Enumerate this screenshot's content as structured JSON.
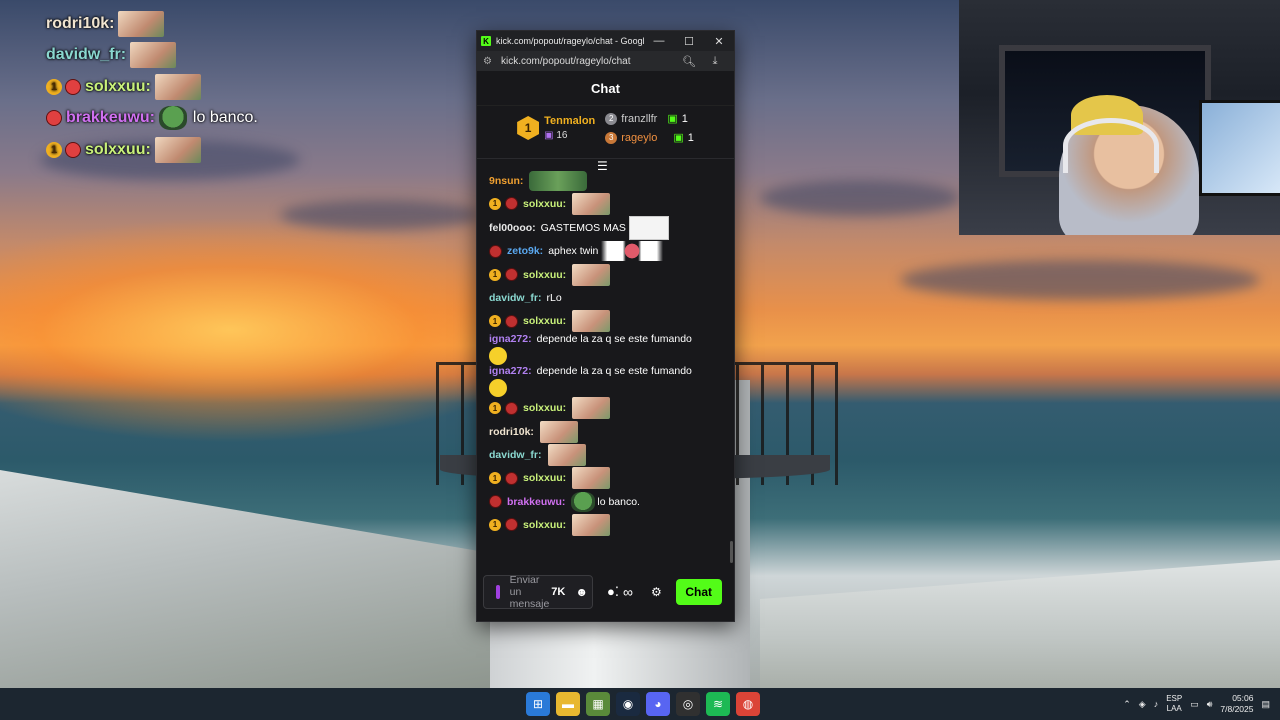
{
  "overlay": {
    "lines": [
      {
        "user": "rodri10k:",
        "color": "#f0e4d0",
        "sub": "",
        "mouth": false,
        "emote": "face",
        "text": ""
      },
      {
        "user": "davidw_fr:",
        "color": "#8ad8d0",
        "sub": "",
        "mouth": false,
        "emote": "face",
        "text": ""
      },
      {
        "user": "solxxuu:",
        "color": "#c8f07a",
        "sub": "1",
        "mouth": true,
        "emote": "face",
        "text": ""
      },
      {
        "user": "brakkeuwu:",
        "color": "#d070f0",
        "sub": "",
        "mouth": true,
        "emote": "pepe",
        "text": "lo banco."
      },
      {
        "user": "solxxuu:",
        "color": "#c8f07a",
        "sub": "1",
        "mouth": true,
        "emote": "face",
        "text": ""
      }
    ]
  },
  "window": {
    "title": "kick.com/popout/rageylo/chat - Google...",
    "favicon": "K",
    "minimize": "—",
    "maximize": "☐",
    "close": "✕",
    "url": "kick.com/popout/rageylo/chat",
    "site_info_icon": "tune-icon",
    "zoom_icon": "zoom-icon",
    "download_icon": "download-icon"
  },
  "chat": {
    "header": "Chat",
    "leaderboard": {
      "first": {
        "rank": "1",
        "name": "Tenmalon",
        "gifts": "16"
      },
      "second": {
        "rank": "2",
        "name": "franzllfr",
        "count": "1"
      },
      "third": {
        "rank": "3",
        "name": "rageylo",
        "count": "1"
      }
    },
    "messages": [
      {
        "user": "9nsun:",
        "color": "#f0a030",
        "sub": "",
        "mouth": false,
        "emote": "wide",
        "text": ""
      },
      {
        "user": "solxxuu:",
        "color": "#c8f07a",
        "sub": "1",
        "mouth": true,
        "emote": "face",
        "text": ""
      },
      {
        "user": "fel00ooo:",
        "color": "#e8e8e8",
        "sub": "",
        "mouth": false,
        "emote": "",
        "text": "GASTEMOS MAS",
        "trail": "sketch"
      },
      {
        "user": "zeto9k:",
        "color": "#5aa8f0",
        "sub": "",
        "mouth": true,
        "emote": "",
        "text": "aphex twin",
        "trail": "wings"
      },
      {
        "user": "solxxuu:",
        "color": "#c8f07a",
        "sub": "1",
        "mouth": true,
        "emote": "face",
        "text": ""
      },
      {
        "user": "davidw_fr:",
        "color": "#8ad8d0",
        "sub": "",
        "mouth": false,
        "emote": "",
        "text": "rLo"
      },
      {
        "user": "solxxuu:",
        "color": "#c8f07a",
        "sub": "1",
        "mouth": true,
        "emote": "face",
        "text": ""
      },
      {
        "user": "igna272:",
        "color": "#b080f0",
        "sub": "",
        "mouth": false,
        "emote": "",
        "text": "depende la za q se este fumando",
        "trail": "emoji"
      },
      {
        "user": "igna272:",
        "color": "#b080f0",
        "sub": "",
        "mouth": false,
        "emote": "",
        "text": "depende la za q se este fumando",
        "trail": "emoji"
      },
      {
        "user": "solxxuu:",
        "color": "#c8f07a",
        "sub": "1",
        "mouth": true,
        "emote": "face",
        "text": ""
      },
      {
        "user": "rodri10k:",
        "color": "#f0e4d0",
        "sub": "",
        "mouth": false,
        "emote": "face",
        "text": ""
      },
      {
        "user": "davidw_fr:",
        "color": "#8ad8d0",
        "sub": "",
        "mouth": false,
        "emote": "face",
        "text": ""
      },
      {
        "user": "solxxuu:",
        "color": "#c8f07a",
        "sub": "1",
        "mouth": true,
        "emote": "face",
        "text": ""
      },
      {
        "user": "brakkeuwu:",
        "color": "#d070f0",
        "sub": "",
        "mouth": true,
        "emote": "pepe",
        "text": "lo banco."
      },
      {
        "user": "solxxuu:",
        "color": "#c8f07a",
        "sub": "1",
        "mouth": true,
        "emote": "face",
        "text": ""
      }
    ],
    "composer": {
      "placeholder": "Enviar un mensaje",
      "send_label": "Chat",
      "accent": "#53fc18"
    }
  },
  "taskbar": {
    "apps": [
      {
        "name": "start-icon",
        "glyph": "⊞",
        "bg": "#2a7ad8"
      },
      {
        "name": "file-explorer-icon",
        "glyph": "▬",
        "bg": "#e8b830"
      },
      {
        "name": "minecraft-icon",
        "glyph": "▦",
        "bg": "#5a8a3a"
      },
      {
        "name": "steam-icon",
        "glyph": "◉",
        "bg": "#1a2a40"
      },
      {
        "name": "discord-icon",
        "glyph": "◕",
        "bg": "#5865f2"
      },
      {
        "name": "obs-icon",
        "glyph": "◎",
        "bg": "#303030"
      },
      {
        "name": "spotify-icon",
        "glyph": "≋",
        "bg": "#1db954"
      },
      {
        "name": "chrome-icon",
        "glyph": "◍",
        "bg": "#db4437"
      }
    ],
    "lang_top": "ESP",
    "lang_bottom": "LAA",
    "time": "05:06",
    "date": "7/8/2025"
  }
}
